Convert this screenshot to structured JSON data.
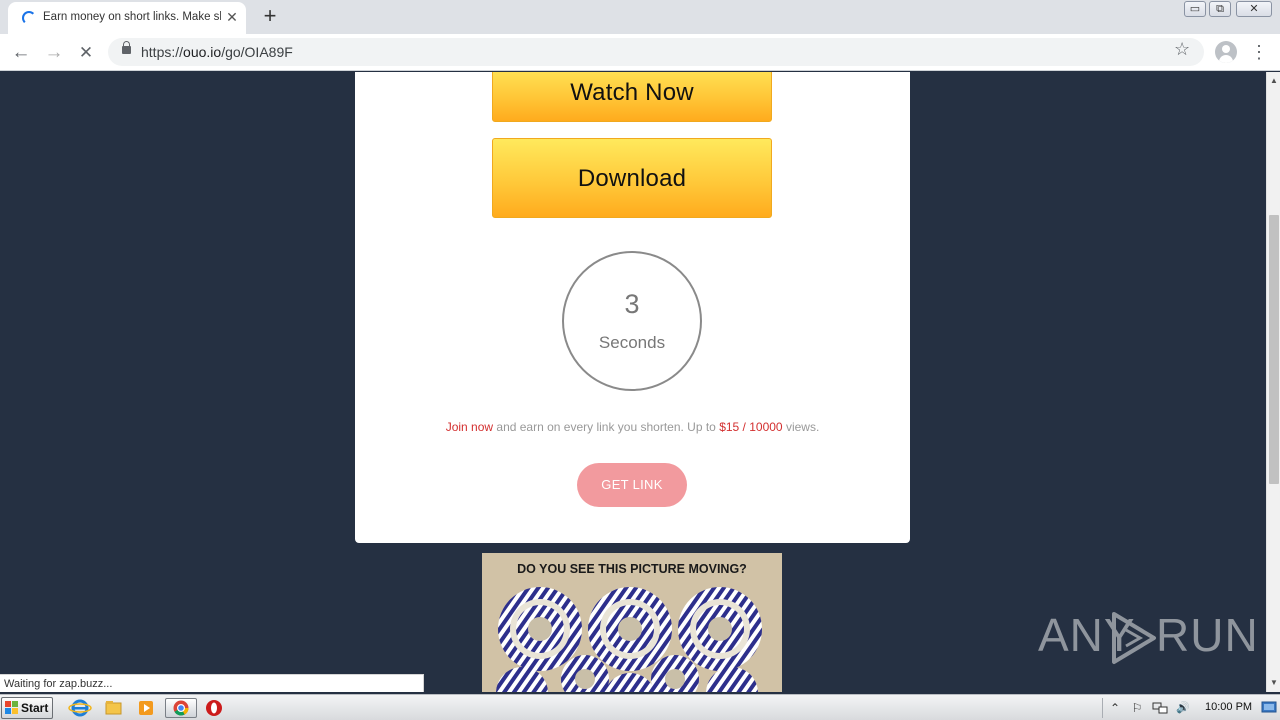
{
  "browser": {
    "tab": {
      "title": "Earn money on short links. Make sho",
      "close_glyph": "✕"
    },
    "new_tab_glyph": "+",
    "window_controls": {
      "minimize": "▭",
      "restore": "⧉",
      "close": "✕"
    },
    "toolbar": {
      "back_glyph": "←",
      "forward_glyph": "→",
      "stop_glyph": "✕",
      "url_scheme": "https://",
      "url_host": "ouo.io",
      "url_path": "/go/OIA89F",
      "bookmark_glyph": "☆",
      "menu_glyph": "⋮"
    },
    "status_text": "Waiting for zap.buzz..."
  },
  "page": {
    "watch_now_label": "Watch Now",
    "download_label": "Download",
    "countdown": {
      "number": "3",
      "unit": "Seconds"
    },
    "promo": {
      "join_link": "Join now",
      "text_middle": " and earn on every link you shorten. Up to ",
      "highlight": "$15 / 10000",
      "text_end": " views."
    },
    "get_link_label": "GET LINK",
    "ad": {
      "headline": "DO YOU SEE THIS PICTURE MOVING?"
    },
    "accent_color": "#d32f2f",
    "button_color": "#ffc93a",
    "background_color": "#253042"
  },
  "watermark": {
    "left": "ANY",
    "right": "RUN"
  },
  "scrollbar": {
    "up_glyph": "▲",
    "down_glyph": "▼"
  },
  "taskbar": {
    "start_label": "Start",
    "apps": [
      "internet-explorer-icon",
      "file-explorer-icon",
      "media-player-icon",
      "chrome-icon",
      "opera-icon"
    ],
    "tray": {
      "expand_glyph": "⌃",
      "flag_glyph": "⚐",
      "volume_glyph": "🔊"
    },
    "clock": "10:00 PM"
  }
}
